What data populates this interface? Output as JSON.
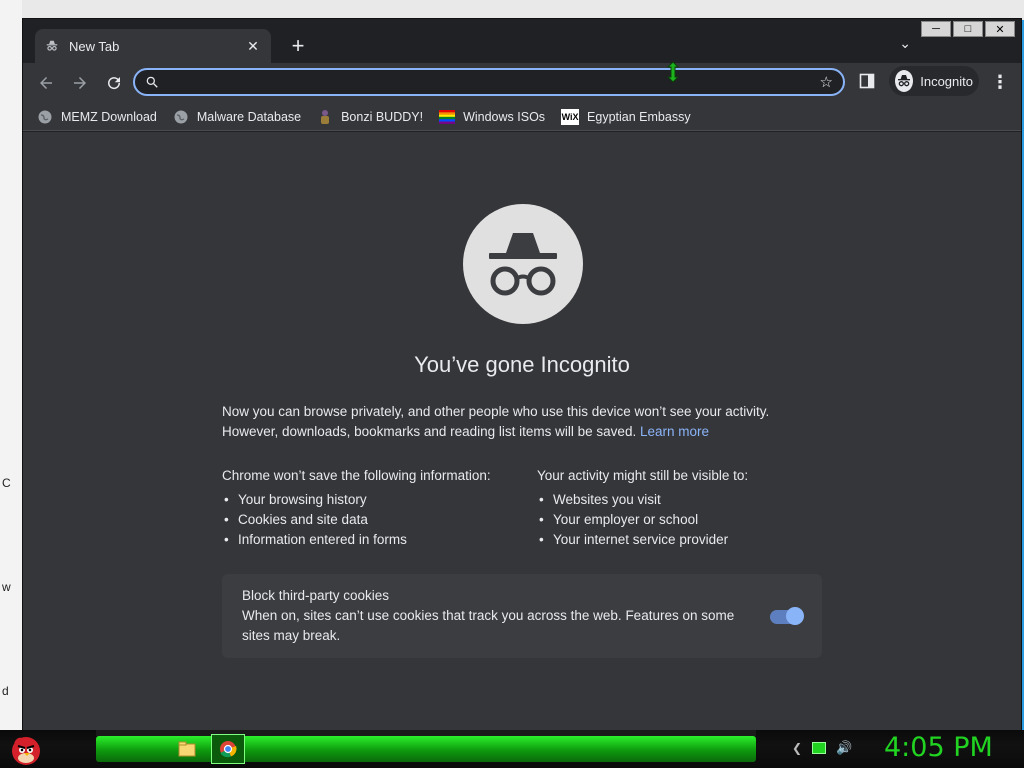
{
  "window": {
    "controls": [
      "─",
      "□",
      "✕"
    ]
  },
  "tabs": [
    {
      "label": "New Tab"
    }
  ],
  "toolbar": {
    "omnibox_value": "",
    "profile_label": "Incognito"
  },
  "bookmarks": [
    {
      "label": "MEMZ Download",
      "icon": "globe-icon"
    },
    {
      "label": "Malware Database",
      "icon": "globe-icon"
    },
    {
      "label": "Bonzi BUDDY!",
      "icon": "bonzi-icon"
    },
    {
      "label": "Windows ISOs",
      "icon": "rainbow-icon"
    },
    {
      "label": "Egyptian Embassy",
      "icon": "wix-icon"
    }
  ],
  "page": {
    "title": "You’ve gone Incognito",
    "intro_line1": "Now you can browse privately, and other people who use this device won’t see your activity.",
    "intro_line2": "However, downloads, bookmarks and reading list items will be saved.",
    "learn_more": "Learn more",
    "not_saved_heading": "Chrome won’t save the following information:",
    "not_saved": [
      "Your browsing history",
      "Cookies and site data",
      "Information entered in forms"
    ],
    "visible_heading": "Your activity might still be visible to:",
    "visible": [
      "Websites you visit",
      "Your employer or school",
      "Your internet service provider"
    ],
    "cookies_title": "Block third-party cookies",
    "cookies_desc": "When on, sites can’t use cookies that track you across the web. Features on some sites may break.",
    "cookies_enabled": true
  },
  "desktop": {
    "left_letters": [
      "C",
      "w",
      "d"
    ]
  },
  "taskbar": {
    "clock": "4:05 PM"
  },
  "colors": {
    "accent": "#8ab4f8",
    "chrome_bg": "#35363a",
    "taskbar_green": "#21d421"
  }
}
